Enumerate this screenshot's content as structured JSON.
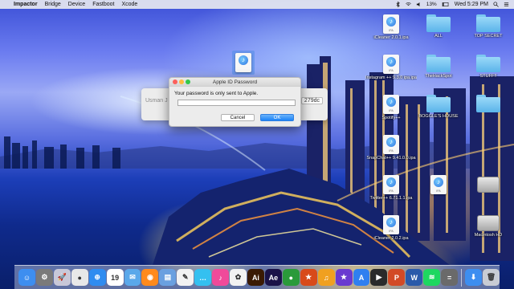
{
  "menubar": {
    "apple_glyph": "",
    "items": [
      "Impactor",
      "Bridge",
      "Device",
      "Fastboot",
      "Xcode"
    ],
    "battery": "13%",
    "clock": "Wed 5:29 PM"
  },
  "desktop_icons": [
    {
      "label": "iCleaner 2.0.1.ipa",
      "icon": "ipa-file-icon",
      "tag": "IPA"
    },
    {
      "label": "ALL",
      "icon": "folder-icon"
    },
    {
      "label": "TOP SECRET",
      "icon": "folder-icon"
    },
    {
      "label": "Instagram ++\n9.3.0 ipa.ipa",
      "icon": "ipa-file-icon",
      "tag": "IPA"
    },
    {
      "label": "TheHackSpot",
      "icon": "folder-icon"
    },
    {
      "label": "STUFF!!",
      "icon": "folder-icon"
    },
    {
      "label": "Spotify++",
      "icon": "ipa-file-icon",
      "tag": "IPA"
    },
    {
      "label": "BOGGLE'S HOUSE",
      "icon": "folder-icon"
    },
    {
      "label": "",
      "icon": "folder-icon"
    },
    {
      "label": "SnapChat++\n9.41.0.0.ipa",
      "icon": "ipa-file-icon",
      "tag": "IPA"
    },
    {
      "label": "Twitter++\n6.71.1.1.ipa",
      "icon": "ipa-file-icon",
      "tag": "IPA"
    },
    {
      "label": "",
      "icon": "ipa-file-icon",
      "tag": "IPA"
    },
    {
      "label": "",
      "icon": "drive-icon"
    },
    {
      "label": "iCleaner 2.0.2.ipa",
      "icon": "ipa-file-icon",
      "tag": "IPA"
    },
    {
      "label": "Macintosh HD",
      "icon": "drive-icon"
    }
  ],
  "background_window": {
    "left_text": "Usman J",
    "right_text": "279dc"
  },
  "dialog": {
    "title": "Apple ID Password",
    "message": "Your password is only sent to Apple.",
    "password_value": "",
    "cancel_label": "Cancel",
    "ok_label": "OK"
  },
  "dock_apps": [
    {
      "name": "finder",
      "color": "#3d8ef0",
      "glyph": "☺"
    },
    {
      "name": "system-preferences",
      "color": "#7a7a7a",
      "glyph": "⚙"
    },
    {
      "name": "launchpad",
      "color": "#c8c8d8",
      "glyph": "🚀"
    },
    {
      "name": "chrome",
      "color": "#e8e8e8",
      "glyph": "●"
    },
    {
      "name": "safari",
      "color": "#2f8cf0",
      "glyph": "⊕"
    },
    {
      "name": "calendar",
      "color": "#ffffff",
      "glyph": "19"
    },
    {
      "name": "mail",
      "color": "#5aa8ea",
      "glyph": "✉"
    },
    {
      "name": "firefox",
      "color": "#ff8a1c",
      "glyph": "◉"
    },
    {
      "name": "preview",
      "color": "#6aa0e0",
      "glyph": "▤"
    },
    {
      "name": "textedit",
      "color": "#f2f2f2",
      "glyph": "✎"
    },
    {
      "name": "messages",
      "color": "#34c0f0",
      "glyph": "…"
    },
    {
      "name": "itunes",
      "color": "#f04a9a",
      "glyph": "♪"
    },
    {
      "name": "photos",
      "color": "#f2f2f2",
      "glyph": "✿"
    },
    {
      "name": "illustrator",
      "color": "#3a1a04",
      "glyph": "Ai"
    },
    {
      "name": "after-effects",
      "color": "#1a1248",
      "glyph": "Ae"
    },
    {
      "name": "camtasia",
      "color": "#2a9a3a",
      "glyph": "●"
    },
    {
      "name": "game-app",
      "color": "#d84a1a",
      "glyph": "★"
    },
    {
      "name": "garageband",
      "color": "#f0a020",
      "glyph": "♫"
    },
    {
      "name": "imovie",
      "color": "#6a3ad0",
      "glyph": "★"
    },
    {
      "name": "app-store",
      "color": "#2f7ff0",
      "glyph": "A"
    },
    {
      "name": "final-cut",
      "color": "#2a2a2a",
      "glyph": "▶"
    },
    {
      "name": "powerpoint",
      "color": "#d24a26",
      "glyph": "P"
    },
    {
      "name": "word",
      "color": "#2a5aaa",
      "glyph": "W"
    },
    {
      "name": "spotify",
      "color": "#1ed760",
      "glyph": "≋"
    },
    {
      "name": "calculator",
      "color": "#6a6a6a",
      "glyph": "="
    },
    {
      "name": "folder-stack",
      "color": "#3d8ef0",
      "glyph": "⬇"
    },
    {
      "name": "trash",
      "color": "#c8ccd4",
      "glyph": "🗑"
    }
  ],
  "colors": {
    "ok_button": "#1b82f7",
    "folder": "#5ab4ea"
  }
}
